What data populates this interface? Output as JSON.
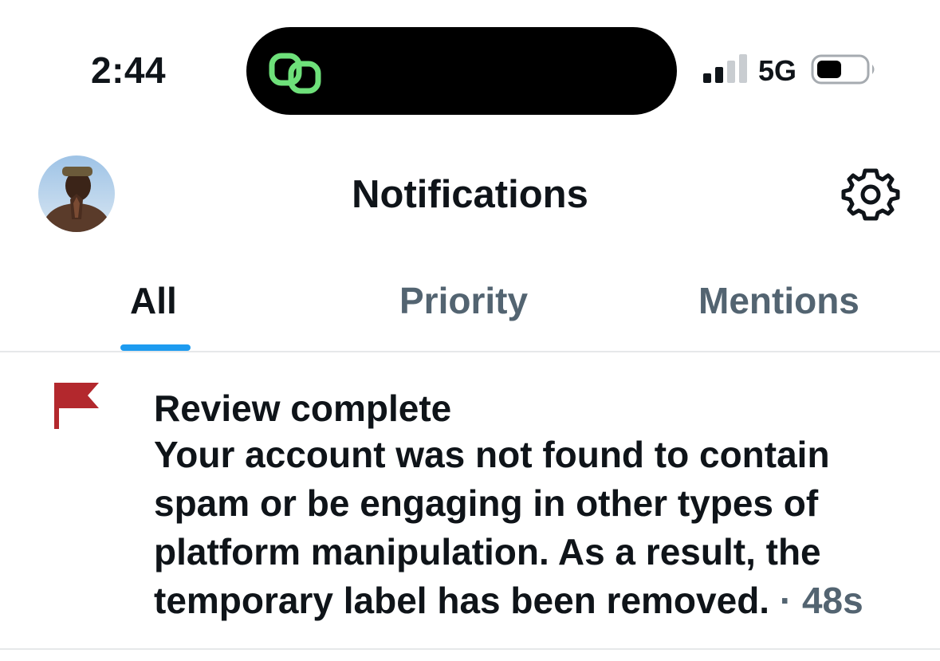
{
  "status_bar": {
    "time": "2:44",
    "network": "5G",
    "island_icon": "linked-rings-icon",
    "island_icon_color": "#6ee07a"
  },
  "header": {
    "title": "Notifications",
    "avatar_icon": "profile-avatar",
    "settings_icon": "gear-icon"
  },
  "tabs": [
    {
      "label": "All",
      "selected": true
    },
    {
      "label": "Priority",
      "selected": false
    },
    {
      "label": "Mentions",
      "selected": false
    }
  ],
  "colors": {
    "accent": "#1d9bf0",
    "text_primary": "#0f1419",
    "text_secondary": "#536471",
    "flag": "#b3282d"
  },
  "notification": {
    "icon": "flag-icon",
    "title": "Review complete",
    "body_lines": [
      "Your account was not found to contain",
      "spam or be engaging in other types of",
      "platform manipulation. As a result, the",
      "temporary label has been removed."
    ],
    "separator": " · ",
    "age": "48s"
  }
}
